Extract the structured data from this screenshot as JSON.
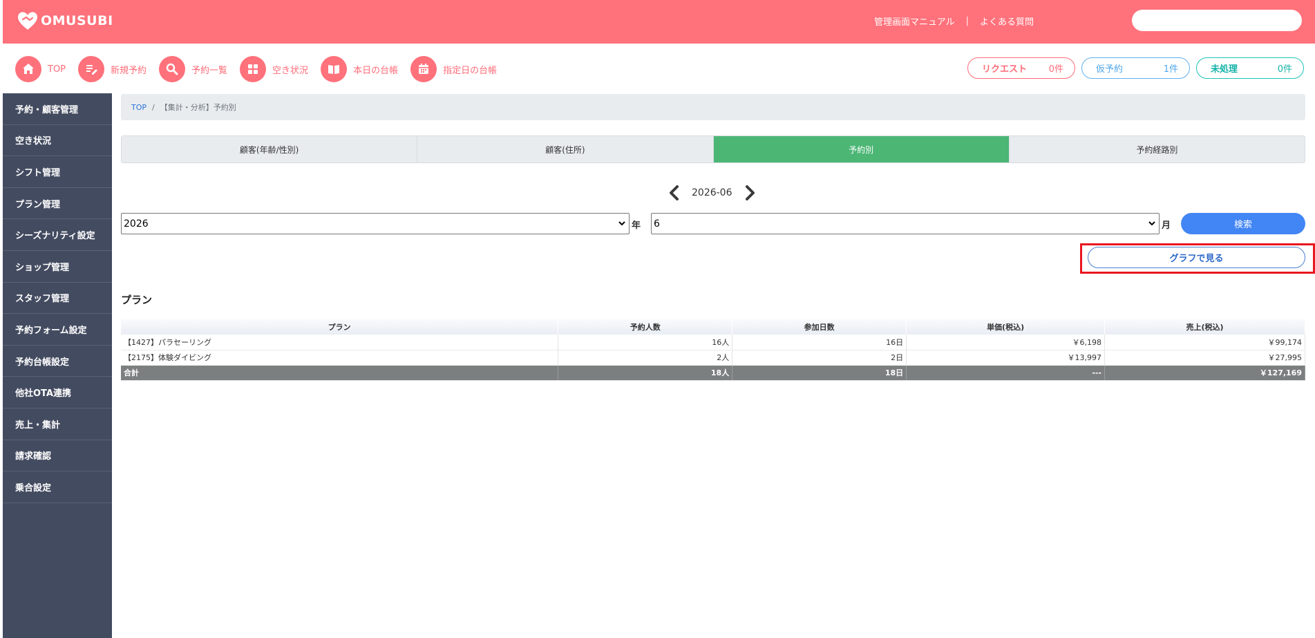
{
  "header": {
    "logo_text": "OMUSUBI",
    "links": [
      "管理画面マニュアル",
      "よくある質問"
    ],
    "link_separator": "|",
    "search_placeholder": ""
  },
  "nav": {
    "items": [
      {
        "label": "TOP",
        "icon": "home-icon"
      },
      {
        "label": "新規予約",
        "icon": "edit-icon"
      },
      {
        "label": "予約一覧",
        "icon": "search-icon"
      },
      {
        "label": "空き状況",
        "icon": "grid-icon"
      },
      {
        "label": "本日の台帳",
        "icon": "book-icon"
      },
      {
        "label": "指定日の台帳",
        "icon": "calendar-icon"
      }
    ],
    "status": {
      "request": {
        "label": "リクエスト",
        "count": "0件"
      },
      "tentative": {
        "label": "仮予約",
        "count": "1件"
      },
      "unprocessed": {
        "label": "未処理",
        "count": "0件"
      }
    }
  },
  "sidebar": {
    "items": [
      "予約・顧客管理",
      "空き状況",
      "シフト管理",
      "プラン管理",
      "シーズナリティ設定",
      "ショップ管理",
      "スタッフ管理",
      "予約フォーム設定",
      "予約台帳設定",
      "他社OTA連携",
      "売上・集計",
      "請求確認",
      "乗合設定"
    ]
  },
  "breadcrumb": {
    "home": "TOP",
    "separator": "/",
    "current": "【集計・分析】予約別"
  },
  "tabs": [
    {
      "label": "顧客(年齢/性別)",
      "active": false
    },
    {
      "label": "顧客(住所)",
      "active": false
    },
    {
      "label": "予約別",
      "active": true
    },
    {
      "label": "予約経路別",
      "active": false
    }
  ],
  "period": {
    "label": "2026-06",
    "year": "2026",
    "year_unit": "年",
    "month": "6",
    "month_unit": "月"
  },
  "buttons": {
    "search": "検索",
    "graph": "グラフで見る"
  },
  "section_title": "プラン",
  "table": {
    "headers": [
      "プラン",
      "予約人数",
      "参加日数",
      "単価(税込)",
      "売上(税込)"
    ],
    "rows": [
      [
        "【1427】パラセーリング",
        "16人",
        "16日",
        "￥6,198",
        "￥99,174"
      ],
      [
        "【2175】体験ダイビング",
        "2人",
        "2日",
        "￥13,997",
        "￥27,995"
      ]
    ],
    "total": [
      "合計",
      "18人",
      "18日",
      "---",
      "￥127,169"
    ]
  },
  "colors": {
    "header_bg": "#ff717b",
    "sidebar_bg": "#434b60",
    "active_tab": "#4cb675",
    "search_button": "#4285f4",
    "highlight_frame": "#e8171f"
  }
}
